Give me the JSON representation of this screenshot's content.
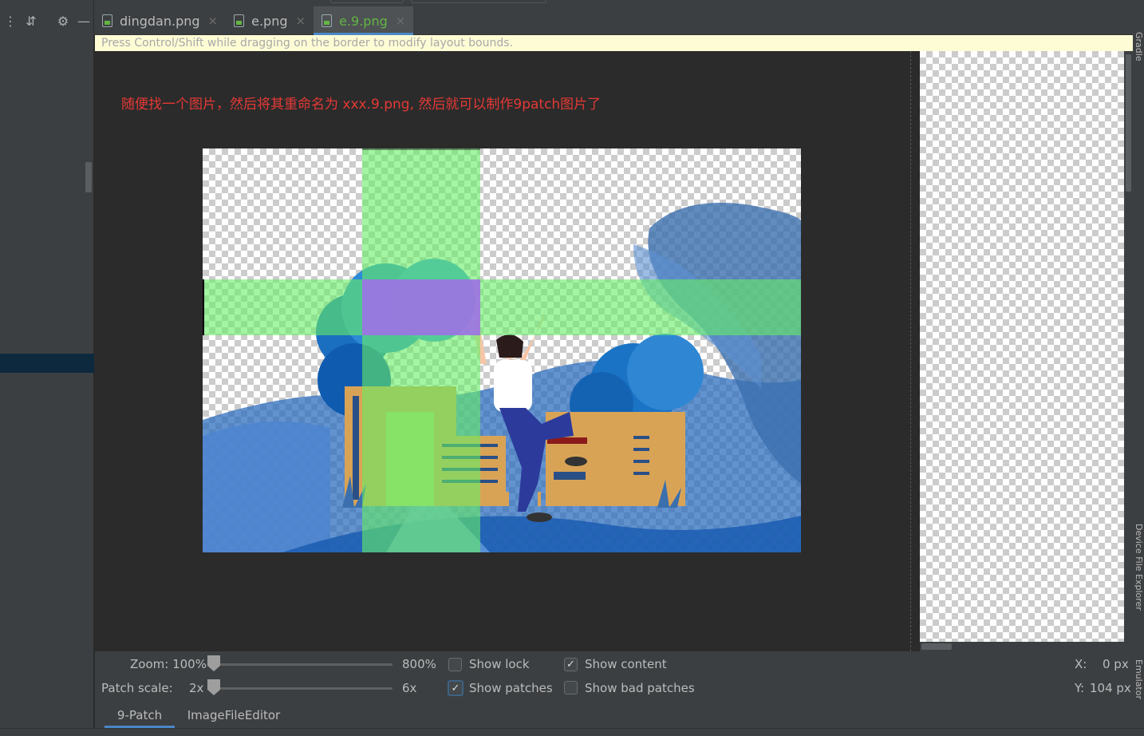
{
  "editor_tabs": [
    {
      "label": "dingdan.png",
      "close": "×"
    },
    {
      "label": "e.png",
      "close": "×"
    },
    {
      "label": "e.9.png",
      "close": "×",
      "active": true
    }
  ],
  "hint": "Press Control/Shift while dragging on the border to modify layout bounds.",
  "annotation": "随便找一个图片，然后将其重命名为 xxx.9.png, 然后就可以制作9patch图片了",
  "annotation_color": "#e53935",
  "patch_colors": {
    "stretch_horizontal": "#7cf07c",
    "stretch_vertical": "#7cf07c",
    "stretch_both": "#b56cff"
  },
  "left_toolbar": {
    "icons": [
      "expand-icon",
      "collapse-all-icon",
      "gear-icon",
      "minimize-icon"
    ],
    "glyphs": [
      "⋮",
      "⇵",
      "⚙",
      "—"
    ]
  },
  "controls": {
    "zoom_label": "Zoom: 100%",
    "zoom_max": "800%",
    "zoom_value": 100,
    "patch_scale_label": "Patch scale:",
    "patch_scale_value": "2x",
    "patch_scale_max": "6x",
    "checkboxes": {
      "show_lock": {
        "label": "Show lock",
        "checked": false,
        "mark": ""
      },
      "show_content": {
        "label": "Show content",
        "checked": true,
        "mark": "✓"
      },
      "show_patches": {
        "label": "Show patches",
        "checked": true,
        "mark": "✓"
      },
      "show_bad_patches": {
        "label": "Show bad patches",
        "checked": false,
        "mark": ""
      }
    },
    "coord_x_label": "X:",
    "coord_x_value": "0 px",
    "coord_y_label": "Y:",
    "coord_y_value": "104 px"
  },
  "bottom_tabs": [
    {
      "label": "9-Patch",
      "active": true
    },
    {
      "label": "ImageFileEditor",
      "active": false
    }
  ],
  "right_strip": {
    "labels": [
      "Gradle",
      "Device File Explorer",
      "Emulator"
    ]
  }
}
